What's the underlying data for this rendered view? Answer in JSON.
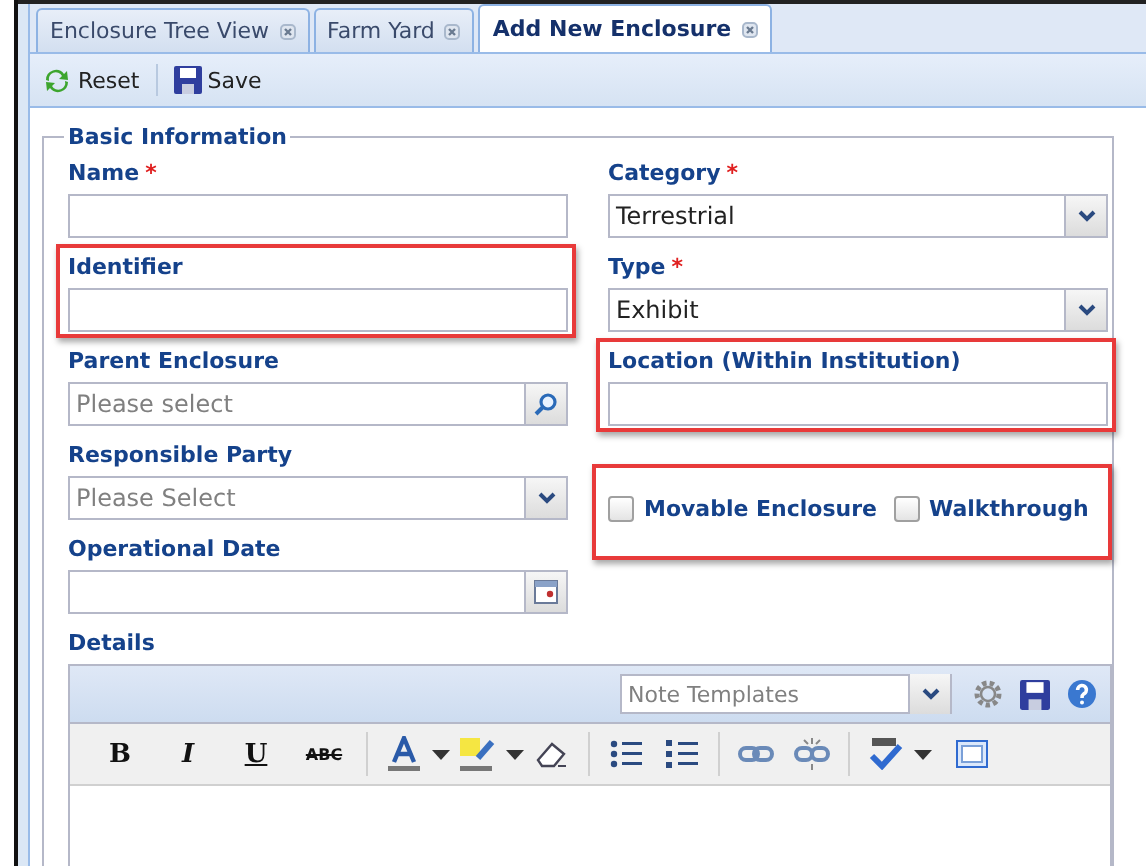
{
  "tabs": [
    {
      "label": "Enclosure Tree View",
      "selected": false
    },
    {
      "label": "Farm Yard",
      "selected": false
    },
    {
      "label": "Add New Enclosure",
      "selected": true
    }
  ],
  "toolbar": [
    {
      "label": "Reset",
      "kind": "reset"
    },
    {
      "label": "Save",
      "kind": "save"
    }
  ],
  "section": {
    "title": "Basic Information"
  },
  "fields": [
    {
      "label": "Name",
      "required_mark": "*",
      "kind": "text",
      "highlighted": false
    },
    {
      "label": "Category",
      "required_mark": "*",
      "kind": "select",
      "value": "Terrestrial",
      "highlighted": false
    },
    {
      "label": "Identifier",
      "kind": "text",
      "highlighted": true
    },
    {
      "label": "Type",
      "required_mark": "*",
      "kind": "select",
      "value": "Exhibit",
      "highlighted": false
    },
    {
      "label": "Parent Enclosure",
      "kind": "search",
      "placeholder": "Please select",
      "highlighted": false
    },
    {
      "label": "Location (Within Institution)",
      "kind": "text",
      "highlighted": true
    },
    {
      "label": "Responsible Party",
      "kind": "select",
      "placeholder": "Please Select",
      "highlighted": false
    },
    {
      "kind": "checks",
      "highlighted": true,
      "checks": [
        {
          "label": "Movable Enclosure",
          "checked": false
        },
        {
          "label": "Walkthrough",
          "checked": false
        }
      ]
    },
    {
      "label": "Operational Date",
      "kind": "date",
      "highlighted": false
    }
  ],
  "details": {
    "label": "Details",
    "template_placeholder": "Note Templates",
    "format_buttons": [
      {
        "label": "B",
        "kind": "bold"
      },
      {
        "label": "I",
        "kind": "italic"
      },
      {
        "label": "U",
        "kind": "underline"
      },
      {
        "label": "ABC",
        "kind": "strike"
      }
    ]
  }
}
